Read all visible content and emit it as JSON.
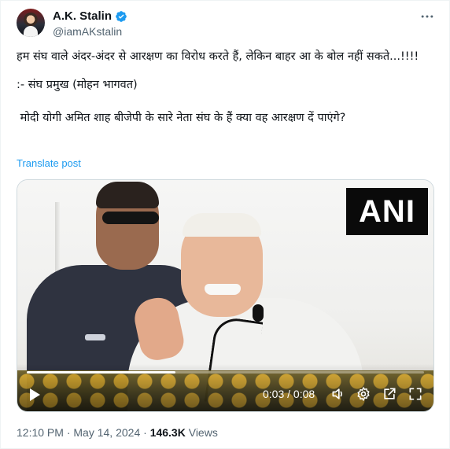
{
  "author": {
    "name": "A.K. Stalin",
    "handle": "@iamAKstalin",
    "verified": true,
    "verified_color": "#1d9bf0"
  },
  "tweet": {
    "lines": [
      "हम संघ वाले अंदर-अंदर से आरक्षण का विरोध करते हैं, लेकिन बाहर आ के बोल नहीं सकते...!!!!",
      ":- संघ प्रमुख (मोहन भागवत)",
      " मोदी योगी अमित शाह बीजेपी के सारे नेता संघ के हैं क्या वह आरक्षण दें पाएंगे?"
    ],
    "translate_label": "Translate post"
  },
  "media": {
    "logo_text": "ANI",
    "progress_fraction": 0.375,
    "current_time": "0:03",
    "duration": "0:08",
    "time_separator": " / "
  },
  "meta": {
    "time": "12:10 PM",
    "dot": " · ",
    "date": "May 14, 2024",
    "views_count": "146.3K",
    "views_label": " Views"
  },
  "icons": {
    "more": "more-icon",
    "verified": "verified-badge-icon",
    "play": "play-icon",
    "volume": "volume-icon",
    "settings": "gear-icon",
    "popout": "popout-icon",
    "fullscreen": "fullscreen-icon"
  }
}
